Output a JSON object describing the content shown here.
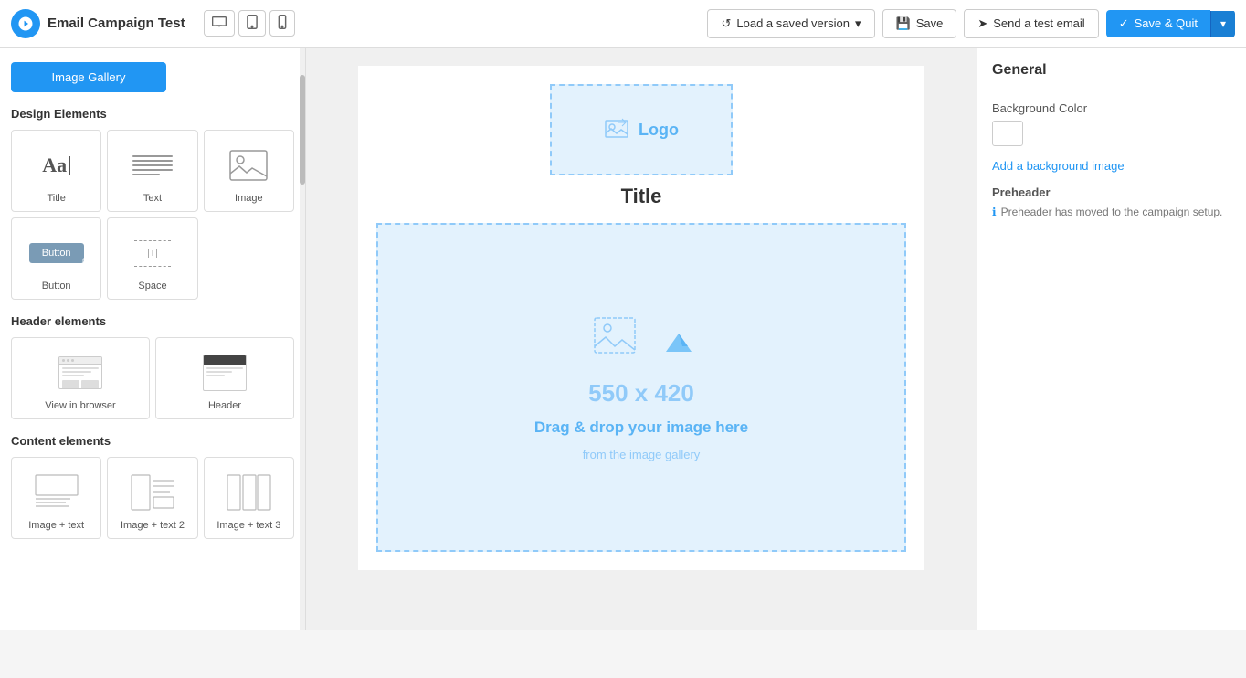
{
  "header": {
    "logo_icon": "✦",
    "title": "Email Campaign Test",
    "device_buttons": [
      {
        "icon": "▭",
        "label": "desktop"
      },
      {
        "icon": "▫",
        "label": "tablet"
      },
      {
        "icon": "▯",
        "label": "mobile"
      }
    ],
    "load_btn": "Load a saved version",
    "save_btn": "Save",
    "test_email_btn": "Send a test email",
    "save_quit_btn": "Save & Quit"
  },
  "sidebar": {
    "image_gallery_btn": "Image Gallery",
    "design_elements_title": "Design Elements",
    "design_elements": [
      {
        "label": "Title",
        "icon": "title"
      },
      {
        "label": "Text",
        "icon": "text"
      },
      {
        "label": "Image",
        "icon": "image"
      },
      {
        "label": "Button",
        "icon": "button"
      },
      {
        "label": "Space",
        "icon": "space"
      }
    ],
    "header_elements_title": "Header elements",
    "header_elements": [
      {
        "label": "View in browser",
        "icon": "browser"
      },
      {
        "label": "Header",
        "icon": "header"
      }
    ],
    "content_elements_title": "Content elements",
    "content_elements": [
      {
        "label": "Image + text",
        "icon": "content1"
      },
      {
        "label": "Image + text 2",
        "icon": "content2"
      },
      {
        "label": "Image + text 3",
        "icon": "content3"
      }
    ]
  },
  "canvas": {
    "logo_text": "Logo",
    "title_text": "Title",
    "image_size": "550 x 420",
    "drag_text": "Drag & drop your image here",
    "drag_sub": "from the image gallery"
  },
  "right_panel": {
    "title": "General",
    "background_color_label": "Background Color",
    "add_bg_link": "Add a background image",
    "preheader_label": "Preheader",
    "preheader_note": "Preheader has moved to the campaign setup."
  }
}
